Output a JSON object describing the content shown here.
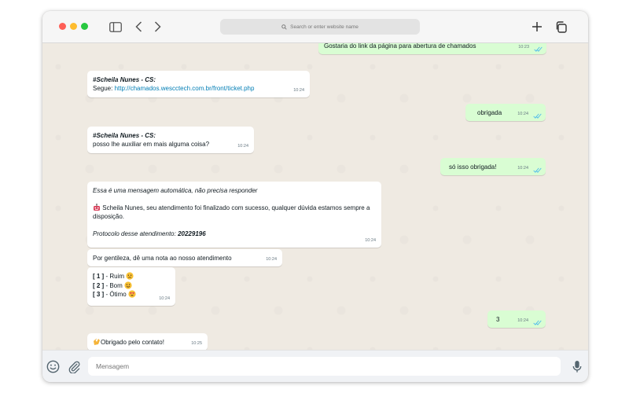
{
  "browser": {
    "address_placeholder": "Search or enter website name"
  },
  "chat": {
    "messages": [
      {
        "text": "Gostaria do link da página para abertura de chamados",
        "time": "10:23"
      },
      {
        "sender": "#Scheila Nunes - CS:",
        "prefix": "Segue: ",
        "link": "http://chamados.wescctech.com.br/front/ticket.php",
        "time": "10:24"
      },
      {
        "text": "obrigada",
        "time": "10:24"
      },
      {
        "sender": "#Scheila Nunes - CS:",
        "text": "posso lhe auxiliar em mais alguma coisa?",
        "time": "10:24"
      },
      {
        "text": "só isso obrigada!",
        "time": "10:24"
      },
      {
        "line1": "Essa é uma mensagem automática, não precisa responder",
        "line2": "Scheila Nunes, seu atendimento foi finalizado com sucesso, qualquer dúvida estamos sempre a disposição.",
        "protocol_label": "Protocolo desse atendimento: ",
        "protocol_number": "20229196",
        "time": "10:24"
      },
      {
        "text": "Por gentileza, dê uma nota ao nosso atendimento",
        "time": "10:24"
      },
      {
        "options": [
          {
            "num": "[ 1 ]",
            "label": " - Ruim",
            "emoji": "sad-face"
          },
          {
            "num": "[ 2 ]",
            "label": " - Bom",
            "emoji": "smiling-face"
          },
          {
            "num": "[ 3 ]",
            "label": " - Ótimo",
            "emoji": "heart-eyes-face"
          }
        ],
        "time": "10:24"
      },
      {
        "text": "3",
        "time": "10:24"
      },
      {
        "text": "Obrigado pelo contato!",
        "emoji": "clapping-hands",
        "time": "10:25"
      }
    ]
  },
  "footer": {
    "input_placeholder": "Mensagem"
  },
  "colors": {
    "incoming_bubble": "#ffffff",
    "outgoing_bubble": "#d9fdd3",
    "chat_background": "#efeae2",
    "read_ticks": "#53bdeb"
  }
}
